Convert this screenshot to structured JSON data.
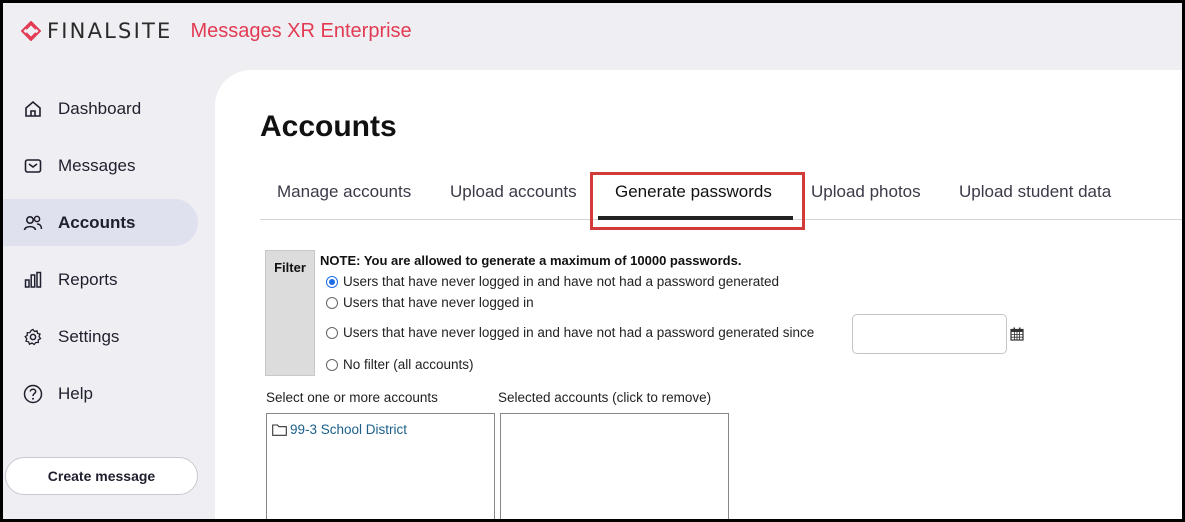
{
  "brand": {
    "name": "FINALSITE",
    "product": "Messages XR Enterprise"
  },
  "sidebar": {
    "items": [
      {
        "label": "Dashboard",
        "icon": "home-icon"
      },
      {
        "label": "Messages",
        "icon": "message-icon"
      },
      {
        "label": "Accounts",
        "icon": "users-icon",
        "active": true
      },
      {
        "label": "Reports",
        "icon": "bar-chart-icon"
      },
      {
        "label": "Settings",
        "icon": "gear-icon"
      },
      {
        "label": "Help",
        "icon": "help-icon"
      }
    ],
    "create_label": "Create message"
  },
  "page": {
    "title": "Accounts"
  },
  "tabs": [
    {
      "label": "Manage accounts"
    },
    {
      "label": "Upload accounts"
    },
    {
      "label": "Generate passwords",
      "active": true
    },
    {
      "label": "Upload photos"
    },
    {
      "label": "Upload student data"
    }
  ],
  "filter": {
    "label": "Filter",
    "note": "NOTE: You are allowed to generate a maximum of 10000 passwords.",
    "options": [
      {
        "label": "Users that have never logged in and have not had a password generated",
        "checked": true
      },
      {
        "label": "Users that have never logged in",
        "checked": false
      },
      {
        "label": "Users that have never logged in and have not had a password generated since",
        "checked": false
      },
      {
        "label": "No filter (all accounts)",
        "checked": false
      }
    ],
    "since_value": ""
  },
  "accounts": {
    "available_label": "Select one or more accounts",
    "selected_label": "Selected accounts (click to remove)",
    "available": [
      "99-3 School District"
    ],
    "selected": []
  },
  "colors": {
    "accent": "#e23b53",
    "highlight_box": "#d33a3a",
    "radio_checked": "#1b6ce6",
    "link": "#1a5f8a"
  }
}
